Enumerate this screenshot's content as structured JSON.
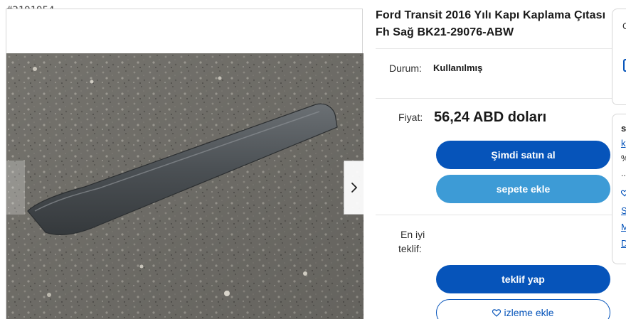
{
  "item_id": "#2191954",
  "listing": {
    "title": "Ford Transit 2016 Yılı Kapı Kaplama Çıtası Fh Sağ BK21-29076-ABW",
    "condition_label": "Durum:",
    "condition_value": "Kullanılmış",
    "price_label": "Fiyat:",
    "price_value": "56,24 ABD doları",
    "best_offer_label_line1": "En iyi",
    "best_offer_label_line2": "teklif:"
  },
  "actions": {
    "buy_now": "Şimdi satın al",
    "add_to_cart": "sepete ekle",
    "make_offer": "teklif yap",
    "watch": "izleme ekle"
  },
  "side_panel": {
    "top_card_letter": "C",
    "seller_initial": "s",
    "seller_link": "k",
    "feedback_symbol": "%",
    "ellipsis": "..",
    "link_1": "S",
    "link_2": "M",
    "link_3": "D"
  },
  "colors": {
    "primary": "#0654ba",
    "secondary": "#3d9bd6"
  }
}
